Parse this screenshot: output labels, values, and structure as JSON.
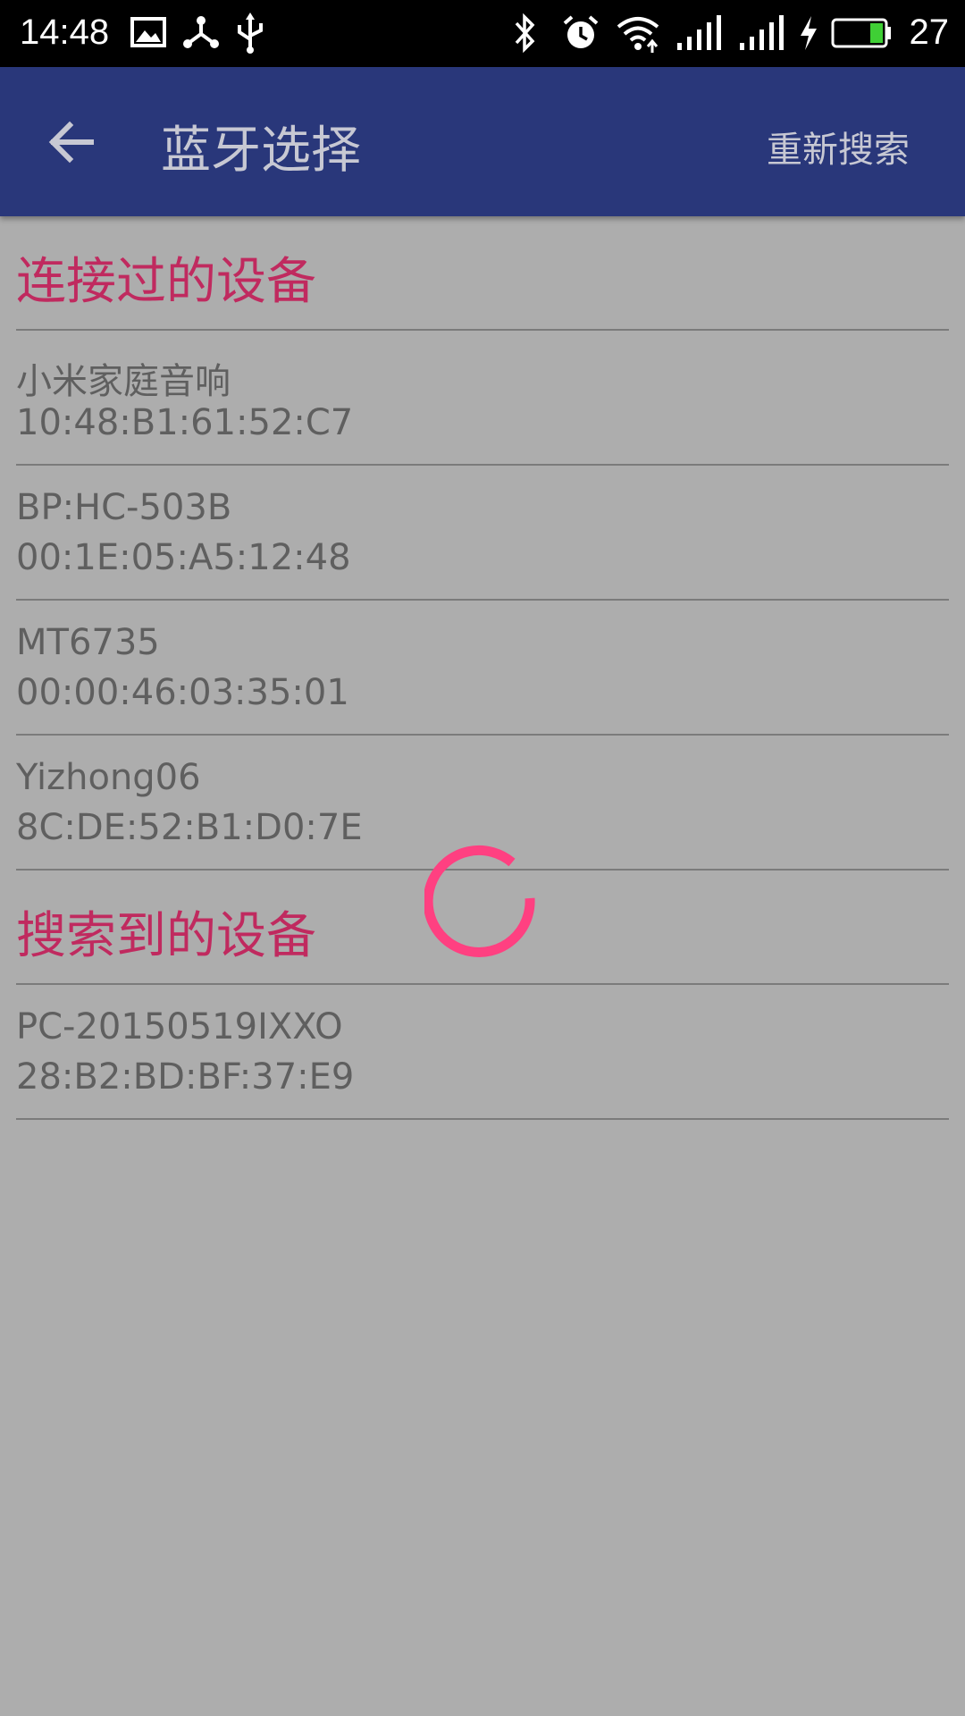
{
  "status_bar": {
    "time": "14:48",
    "battery_percent": "27",
    "icons": [
      "image-icon",
      "share-icon",
      "usb-icon",
      "bluetooth-icon",
      "alarm-icon",
      "wifi-icon",
      "signal-icon",
      "signal-icon-2",
      "charging-icon",
      "battery-icon"
    ]
  },
  "app_bar": {
    "back_icon": "arrow-left-icon",
    "title": "蓝牙选择",
    "action_label": "重新搜索"
  },
  "sections": [
    {
      "header": "连接过的设备",
      "devices": [
        {
          "name": "小米家庭音响",
          "address": "10:48:B1:61:52:C7"
        },
        {
          "name": "BP:HC-503B",
          "address": "00:1E:05:A5:12:48"
        },
        {
          "name": "MT6735",
          "address": "00:00:46:03:35:01"
        },
        {
          "name": "Yizhong06",
          "address": "8C:DE:52:B1:D0:7E"
        }
      ]
    },
    {
      "header": "搜索到的设备",
      "devices": [
        {
          "name": "PC-20150519IXXO",
          "address": "28:B2:BD:BF:37:E9"
        }
      ]
    }
  ],
  "colors": {
    "app_bar": "#29377a",
    "section_header": "#c02a5f",
    "spinner": "#ff4081",
    "background": "#adadad"
  }
}
